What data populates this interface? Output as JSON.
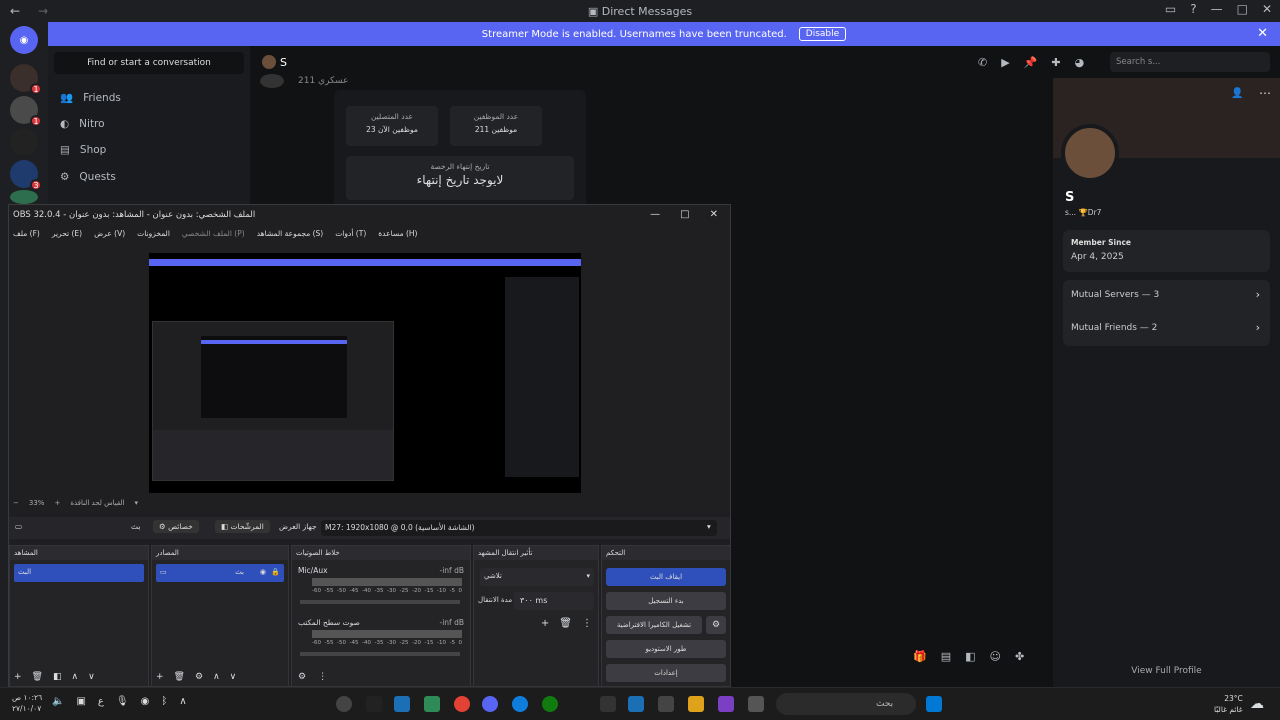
{
  "window": {
    "title": "Direct Messages"
  },
  "streamer": {
    "text": "Streamer Mode is enabled. Usernames have been truncated.",
    "disable": "Disable"
  },
  "dm": {
    "search": "Find or start a conversation",
    "items": [
      "Friends",
      "Nitro",
      "Shop",
      "Quests"
    ]
  },
  "chat": {
    "name": "S",
    "search_placeholder": "Search s...",
    "msg_snippet": "211 عسكري",
    "card1_label": "عدد المتصلين",
    "card1_value": "23 موظفين الآن",
    "card2_label": "عدد الموظفين",
    "card2_value": "211 موظفين",
    "expiry_label": "تاريخ إنتهاء الرخصة",
    "expiry_value": "لايوجد تاريخ إنتهاء"
  },
  "profile": {
    "name": "S",
    "tag": "s...",
    "badge": "Dr7",
    "member_since_label": "Member Since",
    "member_since": "Apr 4, 2025",
    "mutual_servers": "Mutual Servers — 3",
    "mutual_friends": "Mutual Friends — 2",
    "view_full": "View Full Profile"
  },
  "obs": {
    "title": "OBS 32.0.4 - الملف الشخصي: بدون عنوان - المشاهد: بدون عنوان",
    "menu": [
      "ملف (F)",
      "تحرير (E)",
      "عرض (V)",
      "المخزونات",
      "الملف الشخصي (P)",
      "مجموعة المشاهد (S)",
      "أدوات (T)",
      "مساعدة (H)"
    ],
    "zoom": "33%",
    "zoom_label": "القياس لحد النافذة",
    "source_bar": {
      "scene": "بث",
      "properties": "خصائص",
      "filters": "المرشّحات",
      "device_label": "جهاز العرض",
      "device": "M27: 1920x1080 @ 0,0 (الشاشة الأساسية)"
    },
    "scenes": {
      "title": "المشاهد",
      "item": "البث"
    },
    "sources": {
      "title": "المصادر",
      "item": "بث"
    },
    "mixer": {
      "title": "خلاط الصوتيات",
      "ch1": "Mic/Aux",
      "ch1_db": "-inf dB",
      "ch2": "صوت سطح المكتب",
      "ch2_db": "-inf dB",
      "scale": [
        "-60",
        "-55",
        "-50",
        "-45",
        "-40",
        "-35",
        "-30",
        "-25",
        "-20",
        "-15",
        "-10",
        "-5",
        "0"
      ]
    },
    "transitions": {
      "title": "تأثير انتقال المشهد",
      "type": "تلاشي",
      "duration_label": "مدة الانتقال",
      "duration": "٣٠٠ ms"
    },
    "controls": {
      "title": "التحكم",
      "stop": "ايقاف البث",
      "record": "بدء التسجيل",
      "vcam": "تشغيل الكاميرا الافتراضية",
      "studio": "طور الاستوديو",
      "settings": "إعدادات"
    }
  },
  "taskbar": {
    "time": "١٠:٢٦ ص",
    "date": "٢٧/١٠/٠٧",
    "search": "بحث",
    "weather_temp": "23°C",
    "weather_desc": "غائم غالبًا",
    "lang": "ع"
  },
  "colors": {
    "accent": "#5865f2",
    "obs_blue": "#2f4fba",
    "bg": "#111214"
  }
}
